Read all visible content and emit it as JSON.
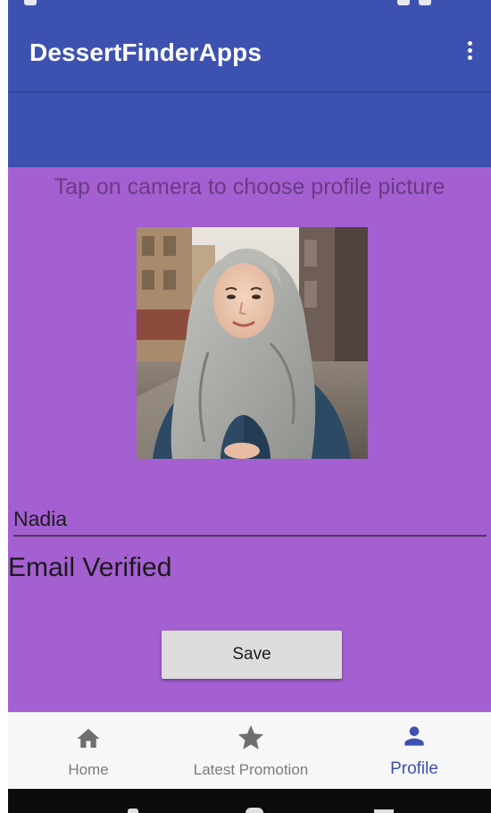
{
  "app": {
    "title": "DessertFinderApps",
    "menu_icon": "more-vert-icon"
  },
  "profile": {
    "hint": "Tap on camera to choose profile picture",
    "photo_alt": "profile picture",
    "name_value": "Nadia",
    "email_status": "Email Verified",
    "save_label": "Save"
  },
  "nav": {
    "items": [
      {
        "label": "Home",
        "icon": "home-icon",
        "active": false
      },
      {
        "label": "Latest Promotion",
        "icon": "star-icon",
        "active": false
      },
      {
        "label": "Profile",
        "icon": "person-icon",
        "active": true
      }
    ]
  },
  "colors": {
    "primary": "#3d52b0",
    "background": "#a45fd1",
    "active_nav": "#3d52b0",
    "inactive_nav": "#7b7b7b"
  }
}
